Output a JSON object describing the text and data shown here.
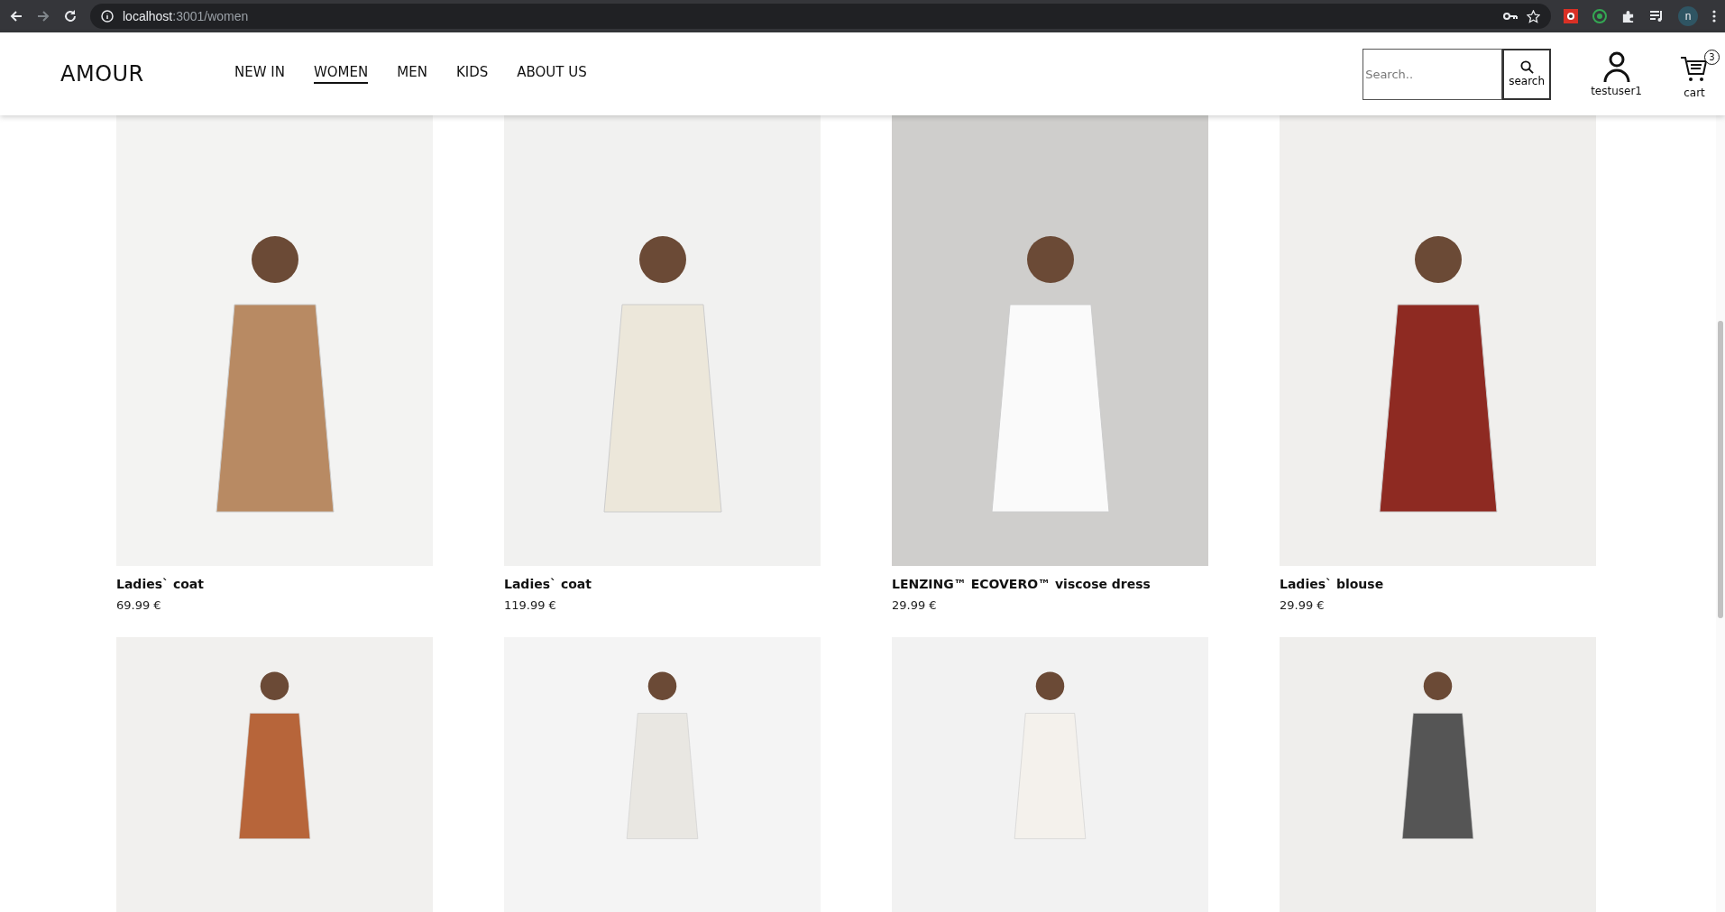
{
  "browser": {
    "url_host": "localhost",
    "url_path": ":3001/women",
    "profile_initial": "n"
  },
  "header": {
    "logo": "AMOUR",
    "nav": [
      {
        "label": "NEW IN",
        "selected": false
      },
      {
        "label": "WOMEN",
        "selected": true
      },
      {
        "label": "MEN",
        "selected": false
      },
      {
        "label": "KIDS",
        "selected": false
      },
      {
        "label": "ABOUT US",
        "selected": false
      }
    ],
    "search": {
      "placeholder": "Search..",
      "button": "search"
    },
    "user": "testuser1",
    "cart": {
      "label": "cart",
      "count": "3"
    }
  },
  "products": [
    {
      "kind": "product",
      "name": "Ladies` coat",
      "price": "69.99 €"
    },
    {
      "kind": "product",
      "name": "Ladies` coat",
      "price": "119.99 €"
    },
    {
      "kind": "product",
      "name": "LENZING™ ECOVERO™ viscose dress",
      "price": "29.99 €"
    },
    {
      "kind": "product",
      "name": "Ladies` blouse",
      "price": "29.99 €"
    },
    {
      "kind": "photo"
    },
    {
      "kind": "photo"
    },
    {
      "kind": "photo"
    },
    {
      "kind": "photo"
    }
  ]
}
